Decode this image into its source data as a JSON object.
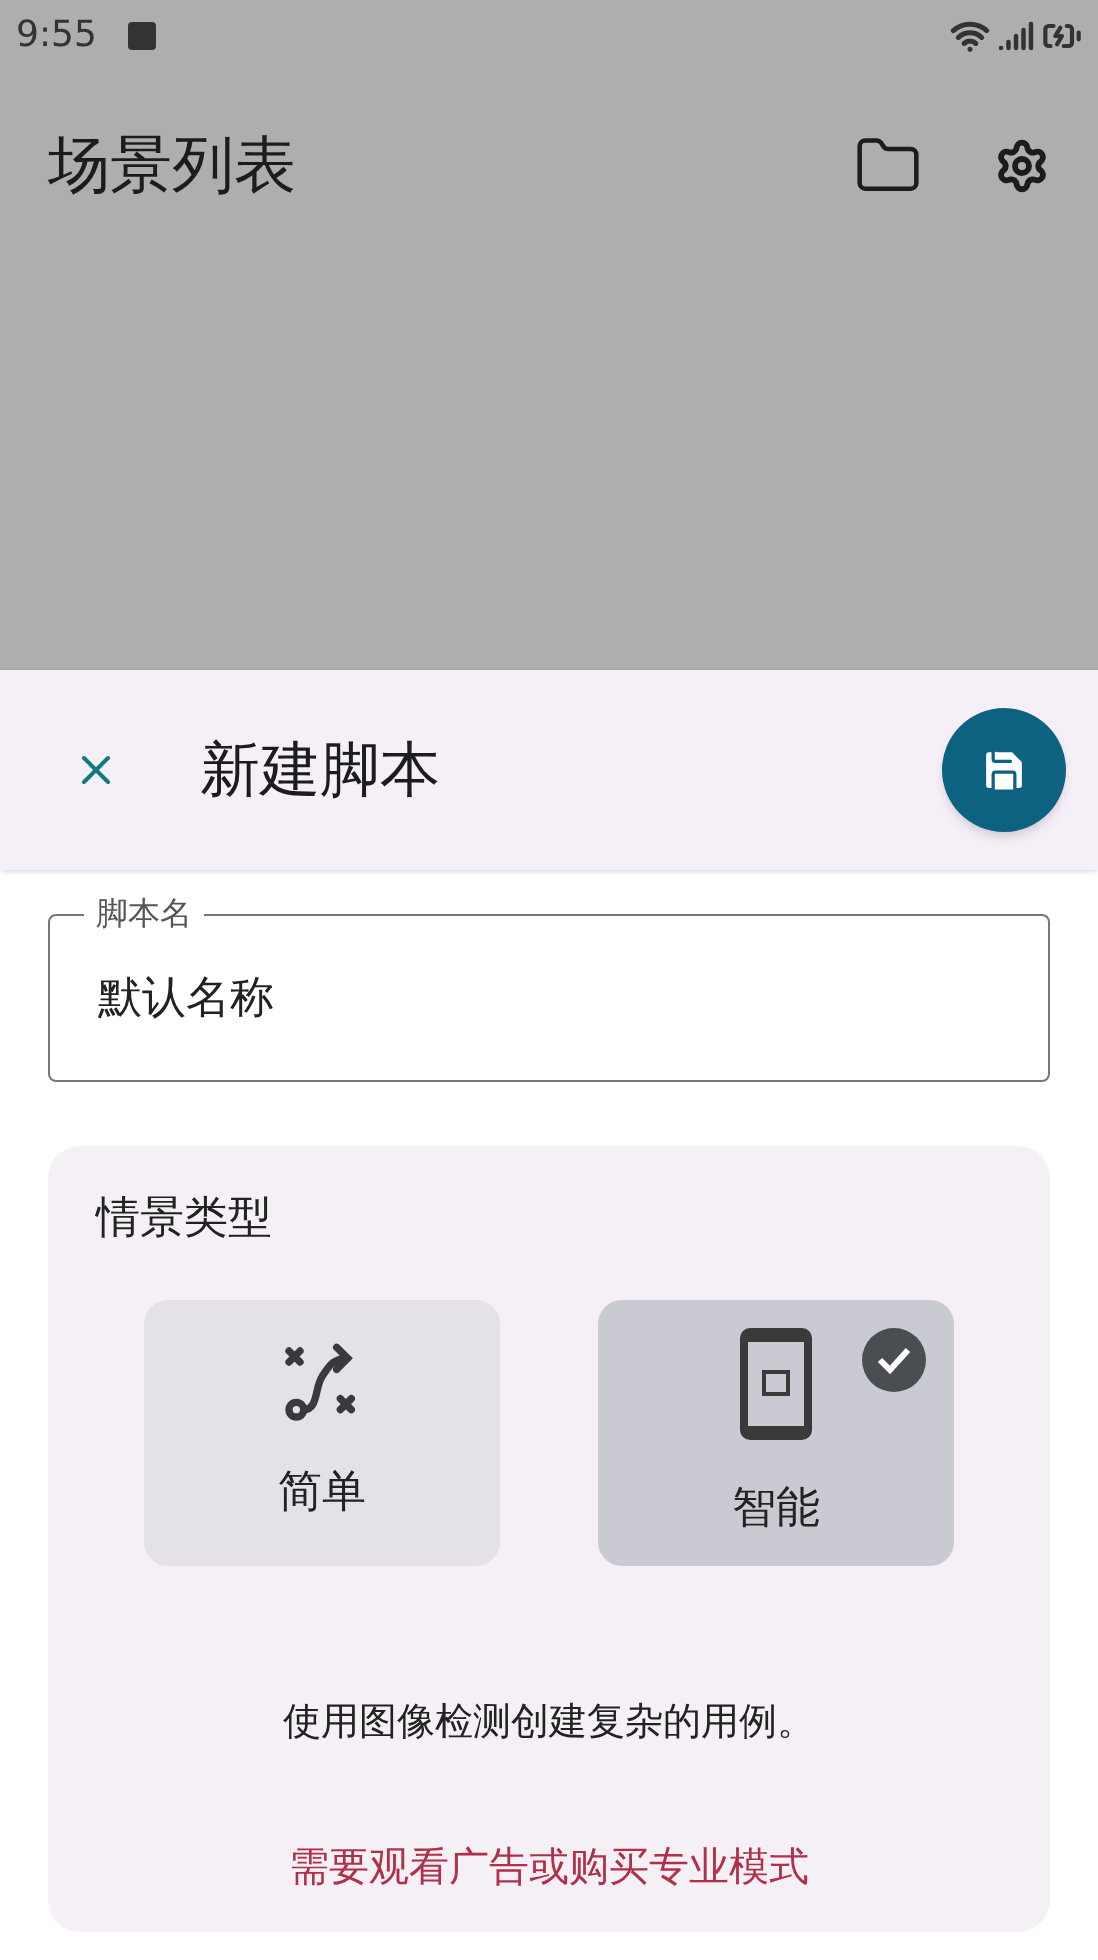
{
  "status_bar": {
    "time": "9:55"
  },
  "app_bar": {
    "title": "场景列表"
  },
  "sheet": {
    "title": "新建脚本",
    "name_field": {
      "label": "脚本名",
      "value": "默认名称"
    },
    "scenario": {
      "title": "情景类型",
      "options": [
        {
          "kind": "simple",
          "label": "简单",
          "selected": false
        },
        {
          "kind": "smart",
          "label": "智能",
          "selected": true
        }
      ],
      "description": "使用图像检测创建复杂的用例。",
      "notice": "需要观看广告或购买专业模式"
    }
  }
}
